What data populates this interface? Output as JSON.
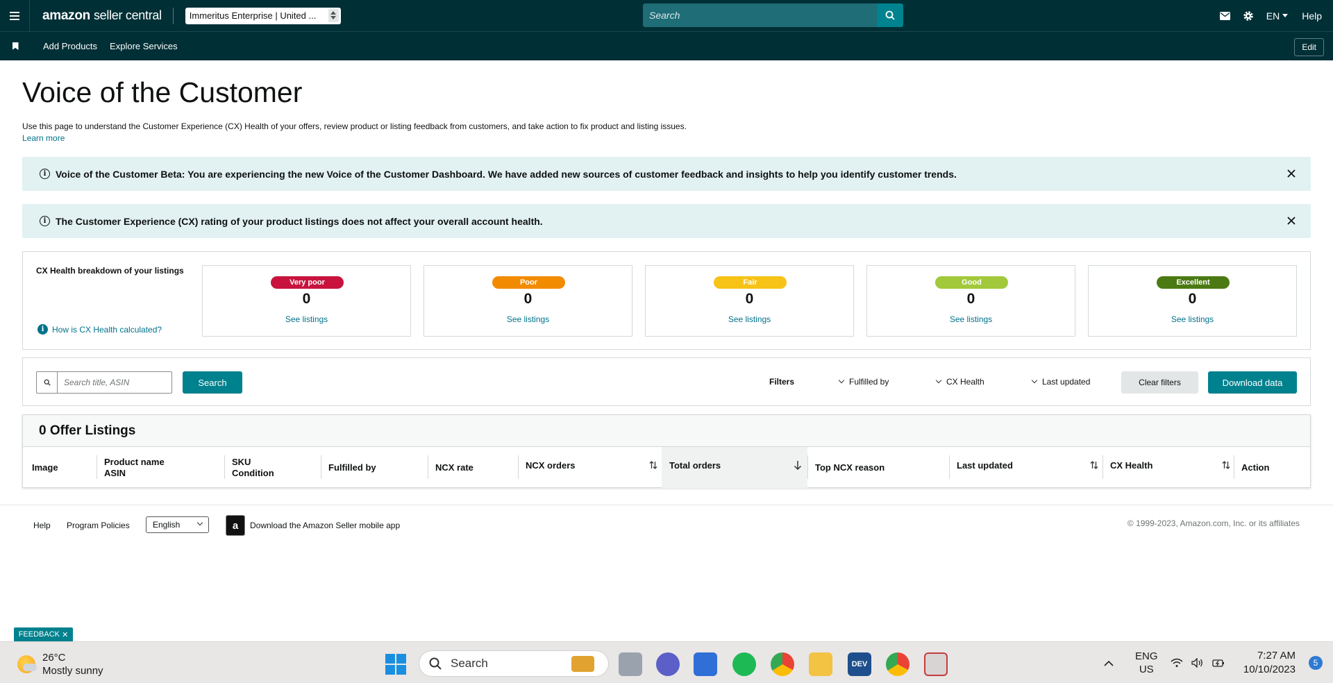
{
  "topnav": {
    "logo_brand": "amazon",
    "logo_suffix": "seller central",
    "account": "Immeritus Enterprise | United ...",
    "search_placeholder": "Search",
    "language": "EN",
    "help": "Help"
  },
  "subnav": {
    "links": [
      "Add Products",
      "Explore Services"
    ],
    "edit": "Edit"
  },
  "page": {
    "title": "Voice of the Customer",
    "description": "Use this page to understand the Customer Experience (CX) Health of your offers, review product or listing feedback from customers, and take action to fix product and listing issues.",
    "learn_more": "Learn more"
  },
  "banners": [
    {
      "text": "Voice of the Customer Beta: You are experiencing the new Voice of the Customer Dashboard. We have added new sources of customer feedback and insights to help you identify customer trends."
    },
    {
      "text": "The Customer Experience (CX) rating of your product listings does not affect your overall account health."
    }
  ],
  "cx_health": {
    "heading": "CX Health breakdown of your listings",
    "how_link": "How is CX Health calculated?",
    "cards": [
      {
        "label": "Very poor",
        "count": "0",
        "link": "See listings",
        "color": "#c7133d"
      },
      {
        "label": "Poor",
        "count": "0",
        "link": "See listings",
        "color": "#f28b00"
      },
      {
        "label": "Fair",
        "count": "0",
        "link": "See listings",
        "color": "#f6c316"
      },
      {
        "label": "Good",
        "count": "0",
        "link": "See listings",
        "color": "#a2c93b"
      },
      {
        "label": "Excellent",
        "count": "0",
        "link": "See listings",
        "color": "#4b7a12"
      }
    ]
  },
  "filters": {
    "search_placeholder": "Search title, ASIN",
    "search_button": "Search",
    "label": "Filters",
    "dropdowns": [
      "Fulfilled by",
      "CX Health",
      "Last updated"
    ],
    "clear": "Clear filters",
    "download": "Download data"
  },
  "table": {
    "heading": "0 Offer Listings",
    "columns": [
      {
        "label": "Image"
      },
      {
        "label": "Product name",
        "sub": "ASIN"
      },
      {
        "label": "SKU",
        "sub": "Condition"
      },
      {
        "label": "Fulfilled by"
      },
      {
        "label": "NCX rate"
      },
      {
        "label": "NCX orders"
      },
      {
        "label": "Total orders"
      },
      {
        "label": "Top NCX reason"
      },
      {
        "label": "Last updated"
      },
      {
        "label": "CX Health"
      },
      {
        "label": "Action"
      }
    ]
  },
  "footer": {
    "help": "Help",
    "policies": "Program Policies",
    "language": "English",
    "app_text": "Download the Amazon Seller mobile app",
    "copyright": "© 1999-2023, Amazon.com, Inc. or its affiliates"
  },
  "feedback": "FEEDBACK",
  "taskbar": {
    "temp": "26°C",
    "weather": "Mostly sunny",
    "search": "Search",
    "lang_top": "ENG",
    "lang_bottom": "US",
    "time": "7:27 AM",
    "date": "10/10/2023",
    "notifications": "5"
  }
}
